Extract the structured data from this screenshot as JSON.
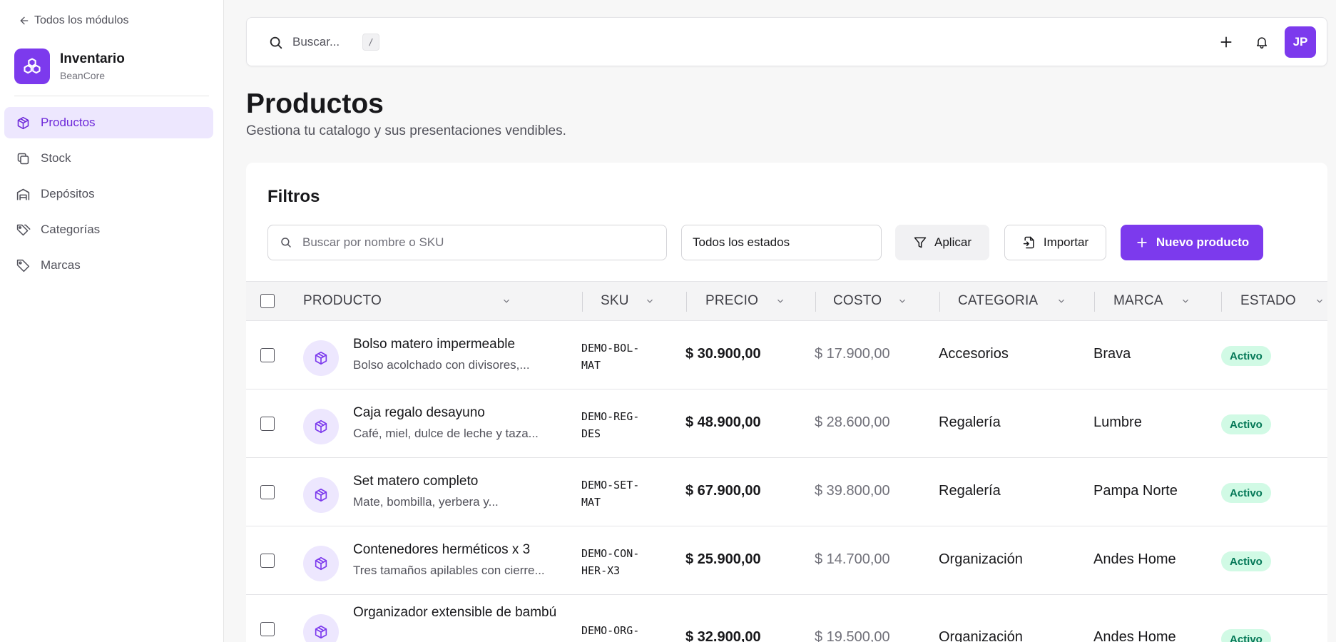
{
  "sidebar": {
    "back_label": "Todos los módulos",
    "module_name": "Inventario",
    "module_sub": "BeanCore",
    "items": [
      {
        "label": "Productos",
        "icon": "box-icon"
      },
      {
        "label": "Stock",
        "icon": "copy-icon"
      },
      {
        "label": "Depósitos",
        "icon": "warehouse-icon"
      },
      {
        "label": "Categorías",
        "icon": "tags-icon"
      },
      {
        "label": "Marcas",
        "icon": "tag-icon"
      }
    ]
  },
  "topbar": {
    "search_placeholder": "Buscar...",
    "shortcut": "/",
    "avatar_initials": "JP"
  },
  "page": {
    "title": "Productos",
    "subtitle": "Gestiona tu catalogo y sus presentaciones vendibles."
  },
  "filters": {
    "title": "Filtros",
    "search_placeholder": "Buscar por nombre o SKU",
    "status_value": "Todos los estados",
    "apply_label": "Aplicar",
    "import_label": "Importar",
    "new_label": "Nuevo producto"
  },
  "table": {
    "columns": [
      "PRODUCTO",
      "SKU",
      "PRECIO",
      "COSTO",
      "CATEGORIA",
      "MARCA",
      "ESTADO"
    ],
    "rows": [
      {
        "name": "Bolso matero impermeable",
        "desc": "Bolso acolchado con divisores,...",
        "sku": "DEMO-BOL-MAT",
        "price": "$ 30.900,00",
        "cost": "$ 17.900,00",
        "category": "Accesorios",
        "brand": "Brava",
        "status": "Activo"
      },
      {
        "name": "Caja regalo desayuno",
        "desc": "Café, miel, dulce de leche y taza...",
        "sku": "DEMO-REG-DES",
        "price": "$ 48.900,00",
        "cost": "$ 28.600,00",
        "category": "Regalería",
        "brand": "Lumbre",
        "status": "Activo"
      },
      {
        "name": "Set matero completo",
        "desc": "Mate, bombilla, yerbera y...",
        "sku": "DEMO-SET-MAT",
        "price": "$ 67.900,00",
        "cost": "$ 39.800,00",
        "category": "Regalería",
        "brand": "Pampa Norte",
        "status": "Activo"
      },
      {
        "name": "Contenedores herméticos x 3",
        "desc": "Tres tamaños apilables con cierre...",
        "sku": "DEMO-CON-HER-X3",
        "price": "$ 25.900,00",
        "cost": "$ 14.700,00",
        "category": "Organización",
        "brand": "Andes Home",
        "status": "Activo"
      },
      {
        "name": "Organizador extensible de bambú",
        "desc": "",
        "sku": "DEMO-ORG-",
        "price": "$ 32.900,00",
        "cost": "$ 19.500,00",
        "category": "Organización",
        "brand": "Andes Home",
        "status": "Activo"
      }
    ]
  },
  "colors": {
    "accent": "#7c3aed",
    "accent_soft": "#ede7fe",
    "status_active_bg": "#d1fae5",
    "status_active_text": "#047857"
  }
}
